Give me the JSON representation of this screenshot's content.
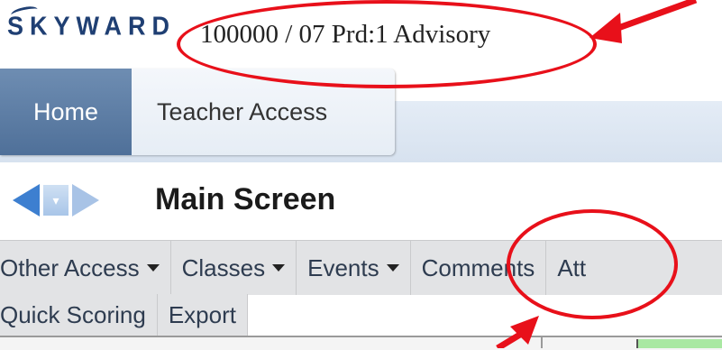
{
  "header": {
    "logo_text": "SKYWARD",
    "class_title": "100000 / 07 Prd:1 Advisory"
  },
  "nav": {
    "tabs": [
      {
        "label": "Home"
      },
      {
        "label": "Teacher Access"
      }
    ]
  },
  "screen": {
    "title": "Main Screen"
  },
  "menu": {
    "row1": [
      {
        "label": "Other Access",
        "dropdown": true
      },
      {
        "label": "Classes",
        "dropdown": true
      },
      {
        "label": "Events",
        "dropdown": true
      },
      {
        "label": "Comments",
        "dropdown": false
      },
      {
        "label": "Att",
        "dropdown": false
      }
    ],
    "row2": [
      {
        "label": "Quick Scoring"
      },
      {
        "label": "Export"
      }
    ]
  },
  "colors": {
    "annotation": "#e8101a",
    "home_tab": "#5a7aa3",
    "logo": "#1f3f73"
  },
  "icons": {
    "back": "arrow-left-icon",
    "history": "dropdown-icon",
    "forward": "arrow-right-icon"
  }
}
